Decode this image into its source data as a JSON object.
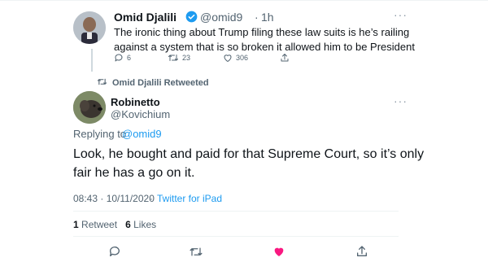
{
  "tweet1": {
    "name": "Omid Djalili",
    "handle": "@omid9",
    "time_sep": "·",
    "time": "1h",
    "text": "The ironic thing about Trump filing these law suits is he’s railing against a system that is so broken it allowed him to be President",
    "replies": "6",
    "retweets": "23",
    "likes": "306",
    "more": "···"
  },
  "retweet_label": "Omid Djalili Retweeted",
  "tweet2": {
    "name": "Robinetto",
    "handle": "@Kovichium",
    "more": "···",
    "replying_prefix": "Replying to",
    "replying_to": "@omid9",
    "text": "Look, he bought and paid for that Supreme Court, so it’s only fair he has a go on it.",
    "timestamp": "08:43 · 10/11/2020",
    "sep": "·",
    "source": "Twitter for iPad",
    "retweet_count": "1",
    "retweet_word": "Retweet",
    "like_count": "6",
    "like_word": "Likes"
  },
  "colors": {
    "accent": "#1d9bf0",
    "like_active": "#f91880",
    "muted": "#536471"
  },
  "icons": [
    "verified-badge-icon",
    "reply-icon",
    "retweet-icon",
    "like-icon",
    "share-icon",
    "more-icon"
  ]
}
